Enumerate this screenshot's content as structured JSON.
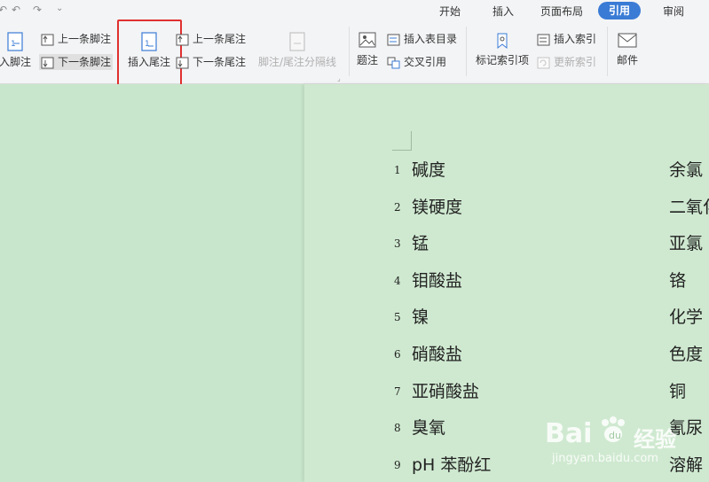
{
  "quick_access": {
    "undo_icon": "undo-icon",
    "redo_icon": "redo-icon",
    "more_icon": "chevron-down-icon"
  },
  "tabs": [
    {
      "label": "开始"
    },
    {
      "label": "插入"
    },
    {
      "label": "页面布局"
    },
    {
      "label": "引用",
      "active": true
    },
    {
      "label": "审阅"
    }
  ],
  "ribbon": {
    "insert_footnote": "入脚注",
    "prev_footnote": "上一条脚注",
    "next_footnote": "下一条脚注",
    "insert_endnote": "插入尾注",
    "prev_endnote": "上一条尾注",
    "next_endnote": "下一条尾注",
    "separator_line": "脚注/尾注分隔线",
    "caption": "题注",
    "insert_toc": "插入表目录",
    "cross_ref": "交叉引用",
    "mark_index": "标记索引项",
    "insert_index": "插入索引",
    "update_index": "更新索引",
    "mail": "邮件"
  },
  "document": {
    "rows": [
      {
        "num": "1",
        "left": "碱度",
        "right": "余氯"
      },
      {
        "num": "2",
        "left": "镁硬度",
        "right": "二氧化"
      },
      {
        "num": "3",
        "left": "锰",
        "right": "亚氯"
      },
      {
        "num": "4",
        "left": "钼酸盐",
        "right": "铬"
      },
      {
        "num": "5",
        "left": "镍",
        "right": "化学"
      },
      {
        "num": "6",
        "left": "硝酸盐",
        "right": "色度"
      },
      {
        "num": "7",
        "left": "亚硝酸盐",
        "right": "铜"
      },
      {
        "num": "8",
        "left": "臭氧",
        "right": "氰尿"
      },
      {
        "num": "9",
        "left": "pH 苯酚红",
        "right": "溶解"
      }
    ]
  },
  "watermark": {
    "brand": "Bai",
    "brand2": "经验",
    "url": "jingyan.baidu.com"
  },
  "colors": {
    "accent": "#3a7bd5",
    "highlight_box": "#e03030",
    "page": "#cfe9d0",
    "canvas": "#c8e6cc"
  }
}
